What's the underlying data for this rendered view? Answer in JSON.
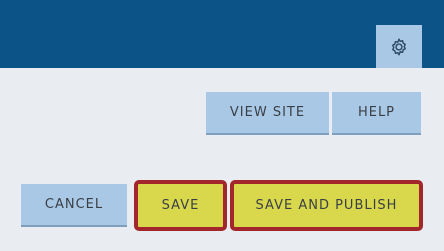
{
  "header": {
    "settings_icon": "gear-icon"
  },
  "actions": {
    "view_site": "VIEW SITE",
    "help": "HELP",
    "cancel": "CANCEL",
    "save": "SAVE",
    "save_and_publish": "SAVE AND PUBLISH"
  },
  "colors": {
    "header_bg": "#0c5487",
    "button_bg": "#a9c8e6",
    "highlight_bg": "#d9d84d",
    "highlight_border": "#a2262b",
    "page_bg": "#e9edf2"
  }
}
